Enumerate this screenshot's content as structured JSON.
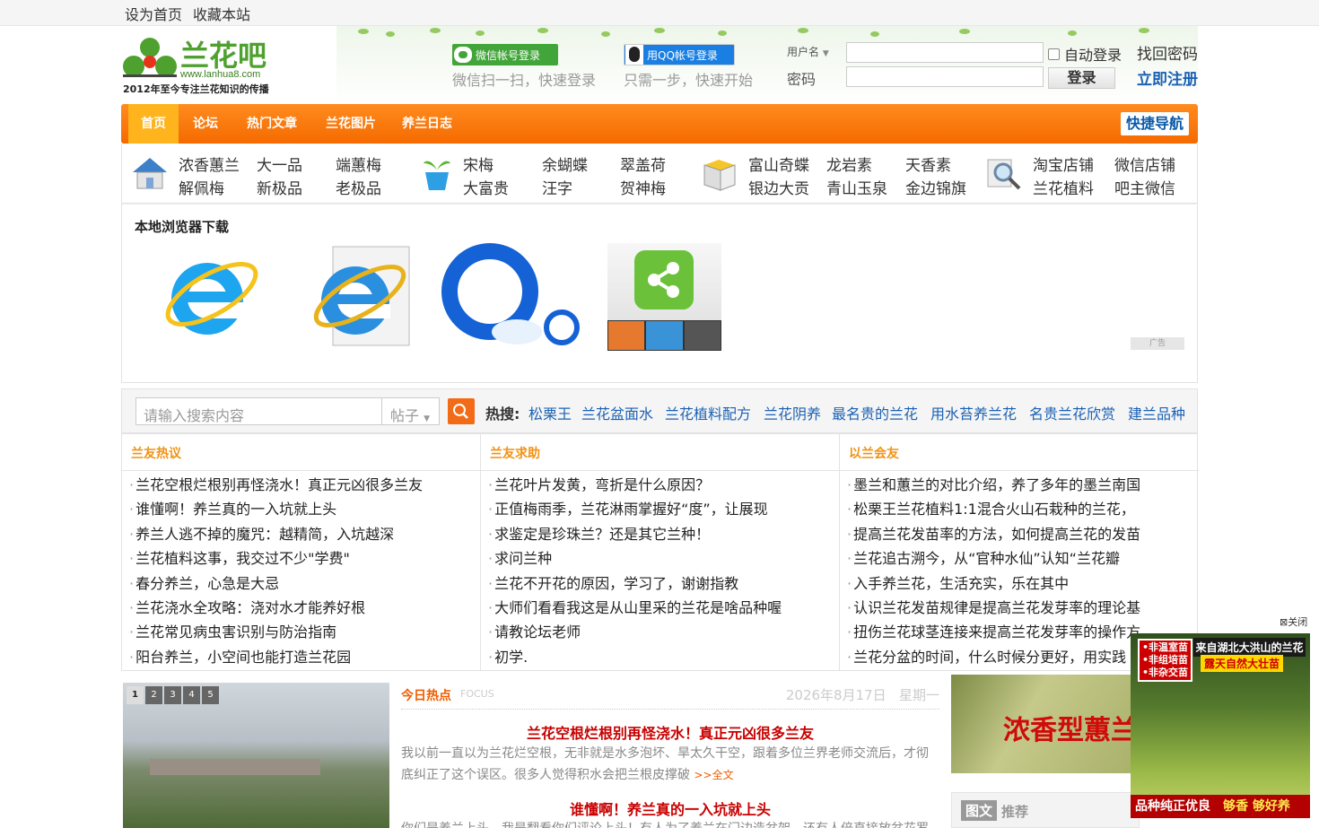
{
  "topbar": {
    "set_home": "设为首页",
    "bookmark": "收藏本站"
  },
  "logo": {
    "name": "兰花吧",
    "url": "www.lanhua8.com",
    "slogan": "2012年至今专注兰花知识的传播"
  },
  "login": {
    "wechat_label": "微信帐号登录",
    "wechat_sub": "微信扫一扫，快速登录",
    "qq_label": "用QQ帐号登录",
    "qq_sub": "只需一步，快速开始",
    "username_label": "用户名",
    "password_label": "密码",
    "auto_login": "自动登录",
    "submit": "登录",
    "find_password": "找回密码",
    "register": "立即注册"
  },
  "nav": {
    "items": [
      "首页",
      "论坛",
      "热门文章",
      "兰花图片",
      "养兰日志"
    ],
    "quick": "快捷导航"
  },
  "categories": {
    "group1": [
      "浓香蕙兰",
      "大一品",
      "端蕙梅",
      "解佩梅",
      "新极品",
      "老极品"
    ],
    "group2": [
      "宋梅",
      "余蝴蝶",
      "翠盖荷",
      "大富贵",
      "汪字",
      "贺神梅"
    ],
    "group3": [
      "富山奇蝶",
      "龙岩素",
      "天香素",
      "银边大贡",
      "青山玉泉",
      "金边锦旗"
    ],
    "group4": [
      "淘宝店铺",
      "微信店铺",
      "兰花植料",
      "吧主微信"
    ]
  },
  "browser_download": {
    "title": "本地浏览器下载",
    "ad_tag": "广告"
  },
  "search": {
    "placeholder": "请输入搜索内容",
    "type": "帖子",
    "hot_label": "热搜:",
    "keywords": [
      "松栗王",
      "兰花盆面水",
      "兰花植料配方",
      "兰花阴养",
      "最名贵的兰花",
      "用水苔养兰花",
      "名贵兰花欣赏",
      "建兰品种"
    ]
  },
  "columns": [
    {
      "title": "兰友热议",
      "items": [
        "兰花空根烂根别再怪浇水！真正元凶很多兰友",
        "谁懂啊！养兰真的一入坑就上头",
        "养兰人逃不掉的魔咒：越精简，入坑越深",
        "兰花植料这事，我交过不少\"学费\"",
        "春分养兰，心急是大忌",
        "兰花浇水全攻略：浇对水才能养好根",
        "兰花常见病虫害识别与防治指南",
        "阳台养兰，小空间也能打造兰花园"
      ]
    },
    {
      "title": "兰友求助",
      "items": [
        "兰花叶片发黄，弯折是什么原因？",
        "正值梅雨季，兰花淋雨掌握好“度”，让展现",
        "求鉴定是珍珠兰？还是其它兰种！",
        "求问兰种",
        "兰花不开花的原因，学习了，谢谢指教",
        "大师们看看我这是从山里采的兰花是啥品种喔",
        "请教论坛老师",
        "初学."
      ]
    },
    {
      "title": "以兰会友",
      "items": [
        "墨兰和蕙兰的对比介绍，养了多年的墨兰南国",
        "松栗王兰花植料1:1混合火山石栽种的兰花，",
        "提高兰花发苗率的方法，如何提高兰花的发苗",
        "兰花追古溯今，从“官种水仙”认知“兰花瓣",
        "入手养兰花，生活充实，乐在其中",
        "认识兰花发苗规律是提高兰花发芽率的理论基",
        "扭伤兰花球茎连接来提高兰花发芽率的操作方",
        "兰花分盆的时间，什么时候分更好，用实践"
      ]
    }
  ],
  "slider": {
    "pages": [
      "1",
      "2",
      "3",
      "4",
      "5"
    ]
  },
  "today": {
    "title": "今日热点",
    "focus": "FOCUS",
    "date": "2026年8月17日",
    "weekday": "星期一",
    "headline1": "兰花空根烂根别再怪浇水！真正元凶很多兰友",
    "summary1": "我以前一直以为兰花烂空根，无非就是水多泡坏、旱太久干空，跟着多位兰界老师交流后，才彻底纠正了这个误区。很多人觉得积水会把兰根皮撑破",
    "more": ">>全文",
    "headline2": "谁懂啊！养兰真的一入坑就上头",
    "summary2": "你们是养兰上头，我是翻看你们评论上头！有人为了养兰在门边造盆架，还有人倍直接放盆花罗"
  },
  "right_pic": {
    "text": "浓香型蕙兰"
  },
  "tuwen": {
    "tag": "图文",
    "label": "推荐"
  },
  "float_ad": {
    "close": "关闭",
    "left_lines": [
      "•非温室苗",
      "•非组培苗",
      "•非杂交苗"
    ],
    "top": "来自湖北大洪山的兰花",
    "sub": "露天自然大壮苗",
    "bottom_a": "品种纯正优良",
    "bottom_b": "够香 够好养"
  }
}
